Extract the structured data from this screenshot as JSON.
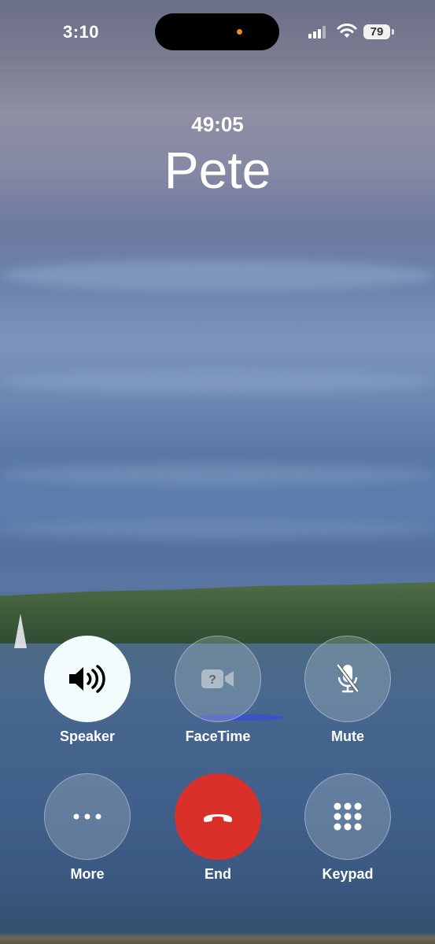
{
  "status": {
    "time": "3:10",
    "battery": "79"
  },
  "call": {
    "duration": "49:05",
    "caller": "Pete"
  },
  "controls": [
    {
      "label": "Speaker",
      "icon": "speaker-wave-icon"
    },
    {
      "label": "FaceTime",
      "icon": "facetime-video-icon"
    },
    {
      "label": "Mute",
      "icon": "microphone-slash-icon"
    },
    {
      "label": "More",
      "icon": "ellipsis-icon"
    },
    {
      "label": "End",
      "icon": "phone-hangup-icon",
      "color": "#d9302a"
    },
    {
      "label": "Keypad",
      "icon": "keypad-grid-icon"
    }
  ]
}
